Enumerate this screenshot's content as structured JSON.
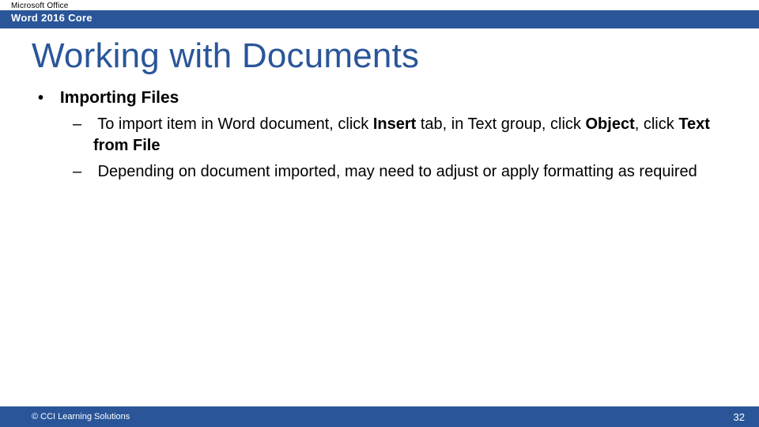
{
  "header": {
    "brand": "Microsoft Office",
    "product": "Word 2016 Core"
  },
  "title": "Working with Documents",
  "bullets": {
    "l1": "Importing Files",
    "l2a_pre": "To import item in Word document, click ",
    "l2a_b1": "Insert",
    "l2a_mid1": " tab, in Text group, click ",
    "l2a_b2": "Object",
    "l2a_mid2": ", click ",
    "l2a_b3": "Text from File",
    "l2b": "Depending on document imported, may need to adjust or apply formatting as required"
  },
  "footer": {
    "copyright": "© CCI Learning Solutions",
    "page": "32"
  }
}
